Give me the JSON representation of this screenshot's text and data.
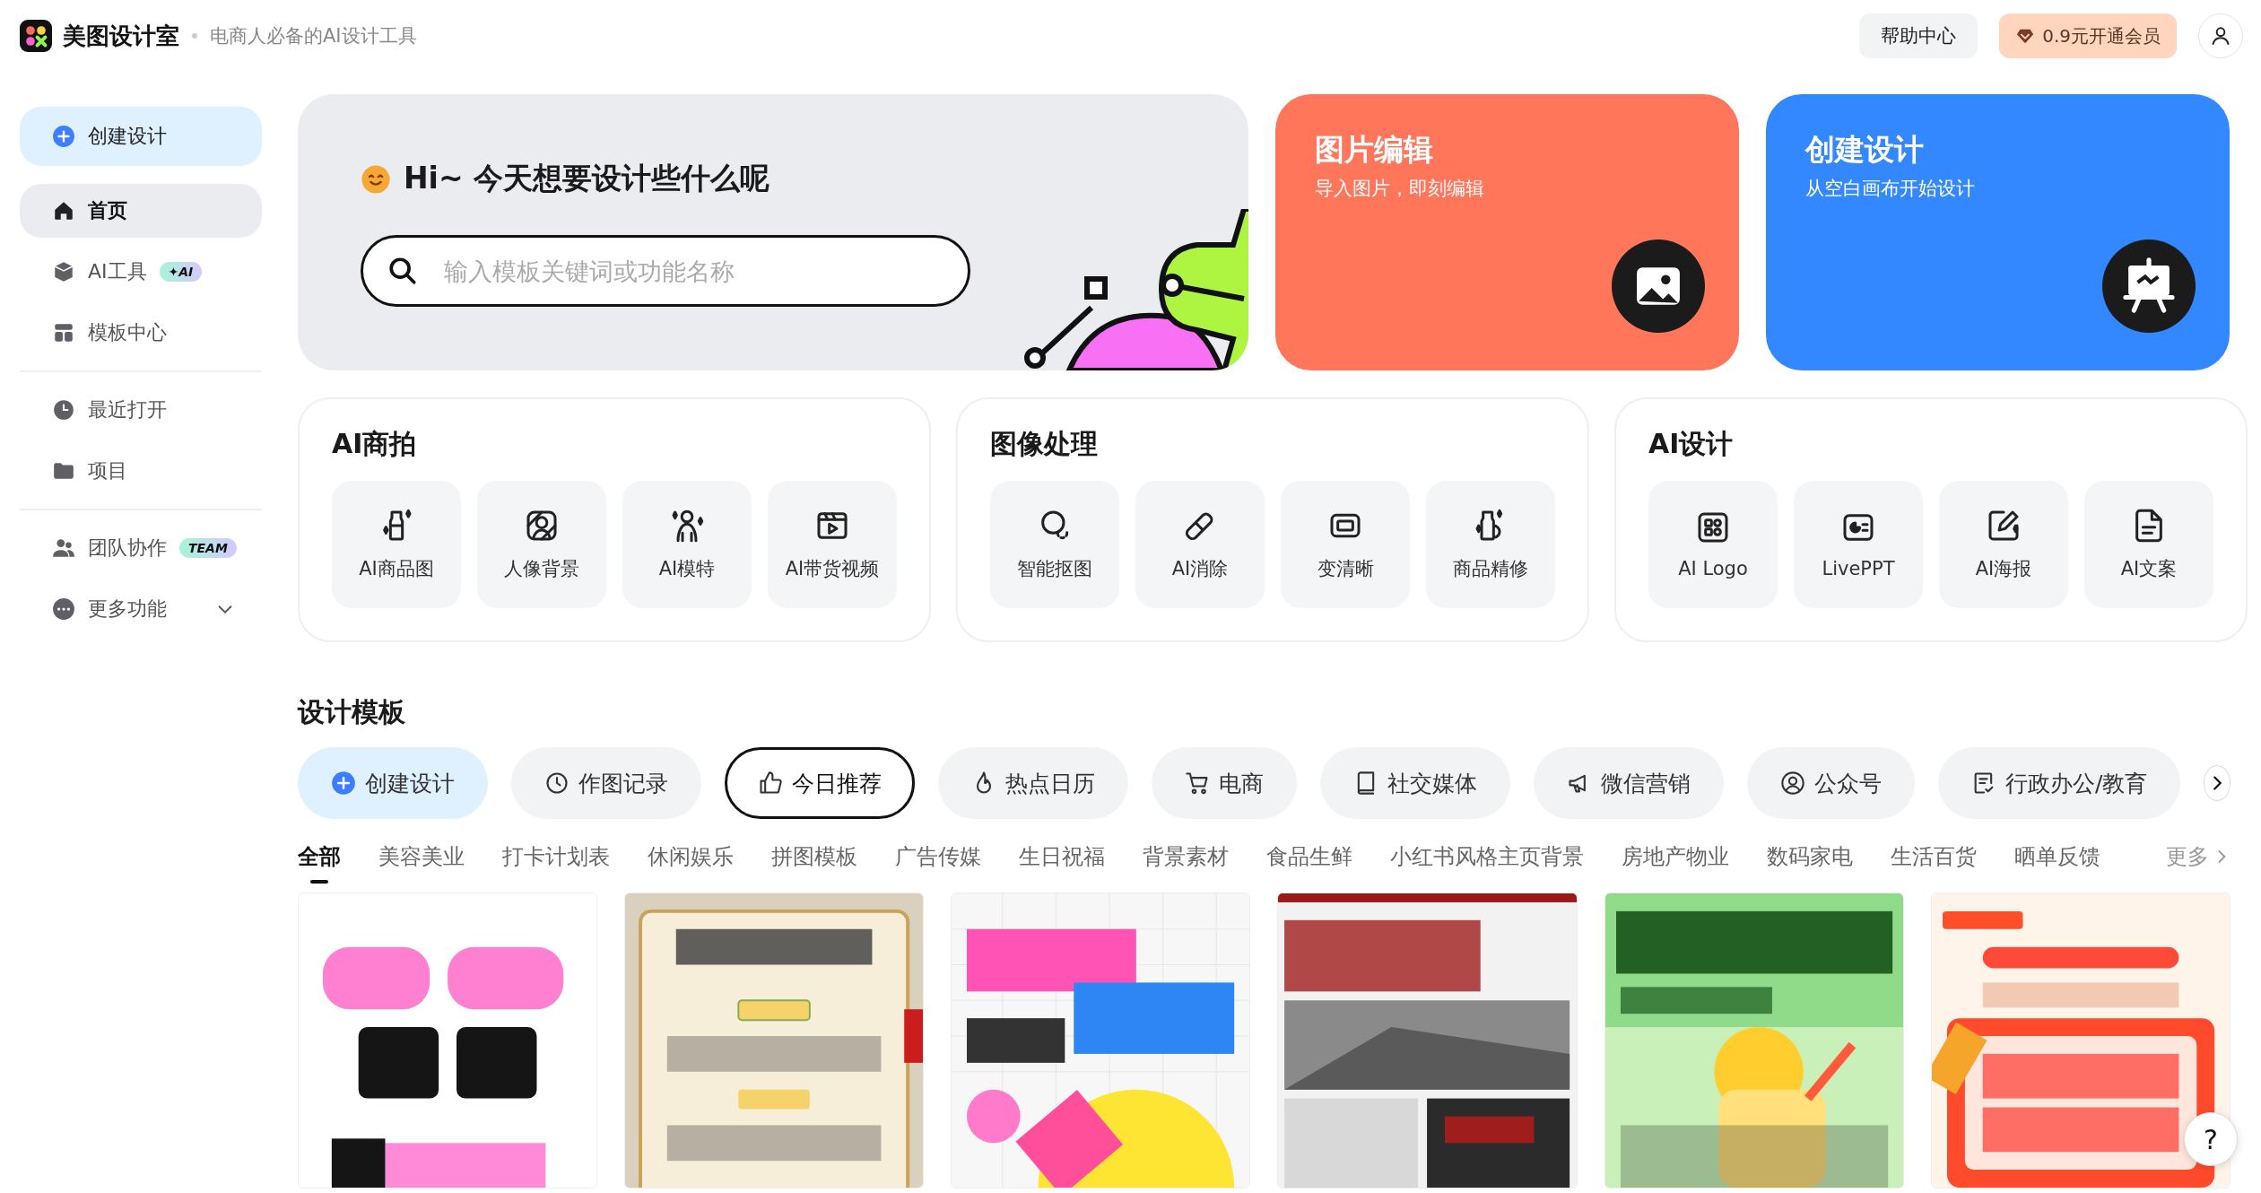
{
  "header": {
    "logo_text": "美图设计室",
    "tagline": "电商人必备的AI设计工具",
    "help": "帮助中心",
    "vip": "0.9元开通会员"
  },
  "sidebar": {
    "groups": [
      [
        {
          "label": "创建设计",
          "kind": "create",
          "selected": false
        },
        {
          "label": "首页",
          "kind": "item",
          "selected": true
        },
        {
          "label": "AI工具",
          "kind": "item",
          "selected": false,
          "badge": "✦AI"
        },
        {
          "label": "模板中心",
          "kind": "item",
          "selected": false
        }
      ],
      [
        {
          "label": "最近打开",
          "kind": "item",
          "selected": false
        },
        {
          "label": "项目",
          "kind": "item",
          "selected": false
        }
      ],
      [
        {
          "label": "团队协作",
          "kind": "item",
          "selected": false,
          "badge": "TEAM"
        },
        {
          "label": "更多功能",
          "kind": "item",
          "selected": false,
          "expanded": false
        }
      ]
    ]
  },
  "hero": {
    "greeting": "Hi~ 今天想要设计些什么呢",
    "search": {
      "placeholder": "输入模板关键词或功能名称"
    },
    "cards": [
      {
        "title": "图片编辑",
        "subtitle": "导入图片，即刻编辑",
        "color": "#ff765b"
      },
      {
        "title": "创建设计",
        "subtitle": "从空白画布开始设计",
        "color": "#3388ff"
      }
    ]
  },
  "tool_groups": [
    {
      "title": "AI商拍",
      "tools": [
        "AI商品图",
        "人像背景",
        "AI模特",
        "AI带货视频"
      ]
    },
    {
      "title": "图像处理",
      "tools": [
        "智能抠图",
        "AI消除",
        "变清晰",
        "商品精修"
      ]
    },
    {
      "title": "AI设计",
      "tools": [
        "AI Logo",
        "LivePPT",
        "AI海报",
        "AI文案"
      ]
    }
  ],
  "templates": {
    "title": "设计模板",
    "categories": [
      {
        "label": "创建设计",
        "kind": "create",
        "selected": false
      },
      {
        "label": "作图记录",
        "kind": "category",
        "selected": false
      },
      {
        "label": "今日推荐",
        "kind": "category",
        "selected": true
      },
      {
        "label": "热点日历",
        "kind": "category",
        "selected": false
      },
      {
        "label": "电商",
        "kind": "category",
        "selected": false
      },
      {
        "label": "社交媒体",
        "kind": "category",
        "selected": false
      },
      {
        "label": "微信营销",
        "kind": "category",
        "selected": false
      },
      {
        "label": "公众号",
        "kind": "category",
        "selected": false
      },
      {
        "label": "行政办公/教育",
        "kind": "category",
        "selected": false
      }
    ],
    "tabs": [
      {
        "label": "全部",
        "selected": true
      },
      {
        "label": "美容美业",
        "selected": false
      },
      {
        "label": "打卡计划表",
        "selected": false
      },
      {
        "label": "休闲娱乐",
        "selected": false
      },
      {
        "label": "拼图模板",
        "selected": false
      },
      {
        "label": "广告传媒",
        "selected": false
      },
      {
        "label": "生日祝福",
        "selected": false
      },
      {
        "label": "背景素材",
        "selected": false
      },
      {
        "label": "食品生鲜",
        "selected": false
      },
      {
        "label": "小红书风格主页背景",
        "selected": false
      },
      {
        "label": "房地产物业",
        "selected": false
      },
      {
        "label": "数码家电",
        "selected": false
      },
      {
        "label": "生活百货",
        "selected": false
      },
      {
        "label": "晒单反馈",
        "selected": false
      }
    ],
    "more": "更多"
  },
  "help_float": "?"
}
